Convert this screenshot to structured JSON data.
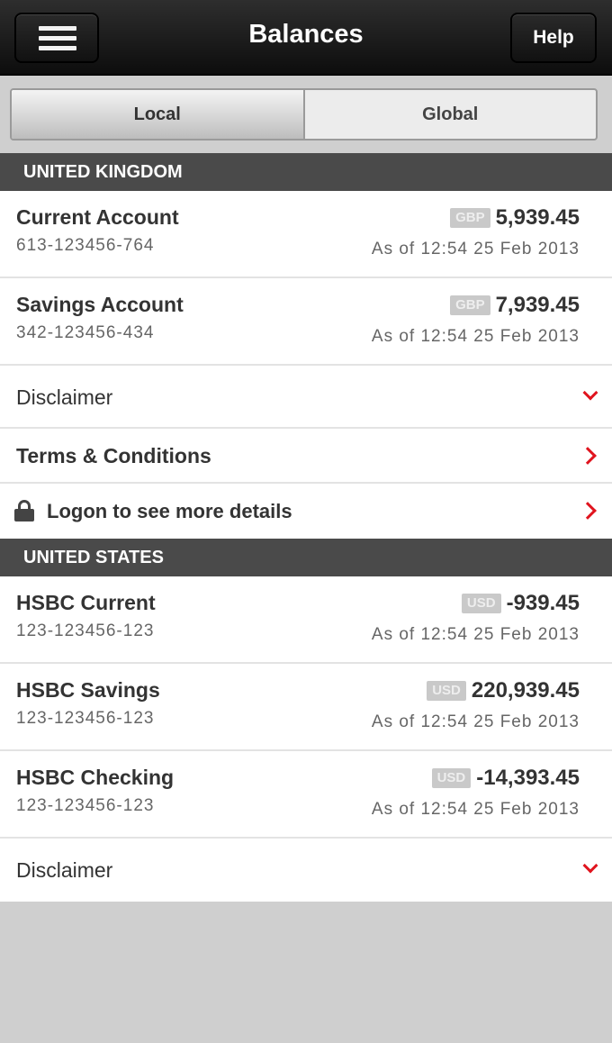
{
  "header": {
    "title": "Balances",
    "help_label": "Help"
  },
  "segments": {
    "local": "Local",
    "global": "Global"
  },
  "uk": {
    "header": "UNITED KINGDOM",
    "accounts": [
      {
        "name": "Current Account",
        "number": "613-123456-764",
        "currency": "GBP",
        "amount": "5,939.45",
        "asof": "As of 12:54 25 Feb 2013"
      },
      {
        "name": "Savings Account",
        "number": "342-123456-434",
        "currency": "GBP",
        "amount": "7,939.45",
        "asof": "As of 12:54 25 Feb 2013"
      }
    ],
    "disclaimer": "Disclaimer",
    "terms": "Terms & Conditions",
    "logon": "Logon to see more details"
  },
  "us": {
    "header": "UNITED STATES",
    "accounts": [
      {
        "name": "HSBC Current",
        "number": "123-123456-123",
        "currency": "USD",
        "amount": "-939.45",
        "asof": "As of 12:54 25 Feb 2013"
      },
      {
        "name": "HSBC Savings",
        "number": "123-123456-123",
        "currency": "USD",
        "amount": "220,939.45",
        "asof": "As of 12:54 25 Feb 2013"
      },
      {
        "name": "HSBC Checking",
        "number": "123-123456-123",
        "currency": "USD",
        "amount": "-14,393.45",
        "asof": "As of 12:54 25 Feb 2013"
      }
    ],
    "disclaimer": "Disclaimer"
  },
  "colors": {
    "accent": "#e0141e",
    "header_bg": "#4a4a4a"
  },
  "icons": [
    "menu-icon",
    "lock-icon",
    "chevron-right-icon",
    "chevron-down-icon"
  ]
}
